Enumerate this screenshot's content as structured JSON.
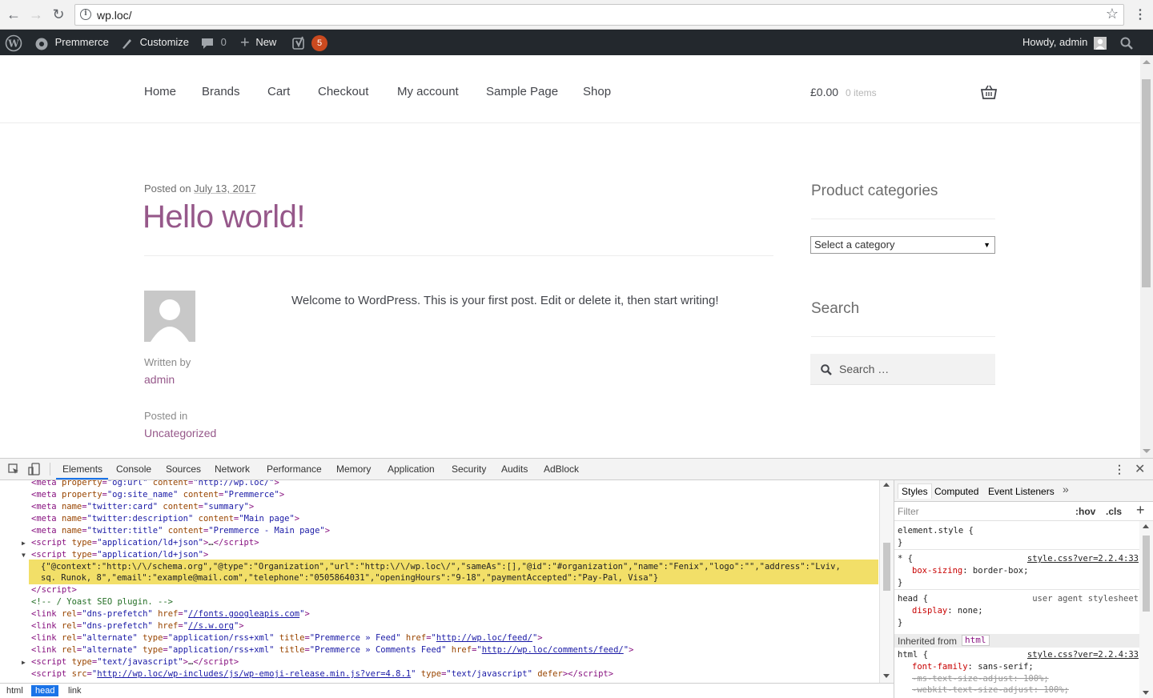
{
  "browser": {
    "url": "wp.loc/"
  },
  "adminbar": {
    "site_name": "Premmerce",
    "customize": "Customize",
    "comments_count": "0",
    "new_label": "New",
    "seo_badge": "5",
    "howdy": "Howdy, admin"
  },
  "nav": {
    "items": [
      "Home",
      "Brands",
      "Cart",
      "Checkout",
      "My account",
      "Sample Page",
      "Shop"
    ],
    "cart_total": "£0.00",
    "cart_count": "0 items"
  },
  "post": {
    "posted_on_label": "Posted on",
    "date": "July 13, 2017",
    "title": "Hello world!",
    "content": "Welcome to WordPress. This is your first post. Edit or delete it, then start writing!",
    "written_by_label": "Written by",
    "author": "admin",
    "posted_in_label": "Posted in",
    "category": "Uncategorized"
  },
  "sidebar": {
    "categories_title": "Product categories",
    "select_placeholder": "Select a category",
    "search_title": "Search",
    "search_placeholder": "Search …"
  },
  "devtools": {
    "tabs": [
      "Elements",
      "Console",
      "Sources",
      "Network",
      "Performance",
      "Memory",
      "Application",
      "Security",
      "Audits",
      "AdBlock"
    ],
    "json_line1": "{\"@context\":\"http:\\/\\/schema.org\",\"@type\":\"Organization\",\"url\":\"http:\\/\\/wp.loc\\/\",\"sameAs\":[],\"@id\":\"#organization\",\"name\":\"Fenix\",\"logo\":\"\",\"address\":\"Lviv,",
    "json_line2": "sq. Runok, 8\",\"email\":\"example@mail.com\",\"telephone\":\"0505864031\",\"openingHours\":\"9-18\",\"paymentAccepted\":\"Pay-Pal, Visa\"}",
    "breadcrumbs": [
      "html",
      "head",
      "link"
    ],
    "styles_tabs": [
      "Styles",
      "Computed",
      "Event Listeners"
    ],
    "filter_placeholder": "Filter",
    "hov": ":hov",
    "cls": ".cls",
    "inherited_label": "Inherited from",
    "inherited_tag": "html",
    "rules": {
      "element_style": "element.style {",
      "star_selector": "* {",
      "star_src": "style.css?ver=2.2.4:33",
      "box_sizing": "box-sizing",
      "box_sizing_val": "border-box;",
      "head_selector": "head {",
      "ua_label": "user agent stylesheet",
      "display": "display",
      "display_val": "none;",
      "html_selector": "html {",
      "html_src": "style.css?ver=2.2.4:33",
      "font_family": "font-family",
      "font_family_val": "sans-serif;",
      "ms_text": "-ms-text-size-adjust: 100%;",
      "webkit_text": "-webkit-text-size-adjust: 100%;"
    }
  },
  "colors": {
    "adminbar_bg": "#23282d",
    "accent_purple": "#96588a",
    "badge_orange": "#ca4a1f",
    "highlight_yellow": "#f2df68",
    "devtools_blue": "#1a73e8"
  }
}
